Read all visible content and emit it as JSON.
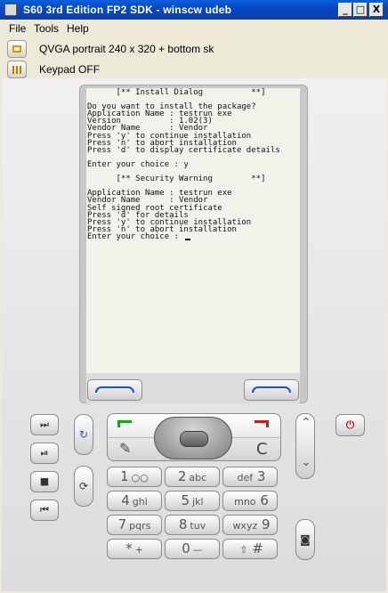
{
  "window": {
    "title": "S60 3rd Edition FP2 SDK - winscw udeb"
  },
  "window_controls": {
    "minimize": "_",
    "maximize": "□",
    "close": "X"
  },
  "menu": [
    "File",
    "Tools",
    "Help"
  ],
  "toolbar": {
    "resolution_label": "QVGA portrait 240 x 320 + bottom sk",
    "keypad_label": "Keypad OFF"
  },
  "screen": {
    "lines": [
      "      [** Install Dialog          **]",
      "",
      "Do you want to install the package?",
      "Application Name : testrun exe",
      "Version          : 1.02(3)",
      "Vendor Name      : Vendor",
      "Press 'y' to continue installation",
      "Press 'n' to abort installation",
      "Press 'd' to display certificate details",
      "",
      "Enter your choice : y",
      "",
      "      [** Security Warning        **]",
      "",
      "Application Name : testrun exe",
      "Vendor Name      : Vendor",
      "Self signed root certificate",
      "Press 'd' for details",
      "Press 'y' to continue installation",
      "Press 'n' to abort installation",
      "Enter your choice : "
    ]
  },
  "keys": {
    "media": [
      "⏭",
      "⏯",
      "■",
      "⏮"
    ],
    "edit": "✎",
    "clear": "C",
    "power": "⏻",
    "camera": "◙",
    "menu": "↻",
    "abc": "⟳",
    "keypad": [
      [
        "1",
        "○○"
      ],
      [
        "2",
        "abc"
      ],
      [
        "def",
        "3"
      ],
      [
        "4",
        "ghi"
      ],
      [
        "5",
        "jkl"
      ],
      [
        "mno",
        "6"
      ],
      [
        "7",
        "pqrs"
      ],
      [
        "8",
        "tuv"
      ],
      [
        "wxyz",
        "9"
      ],
      [
        "*",
        "+"
      ],
      [
        "0",
        "—"
      ],
      [
        "⇧",
        "#"
      ]
    ]
  }
}
